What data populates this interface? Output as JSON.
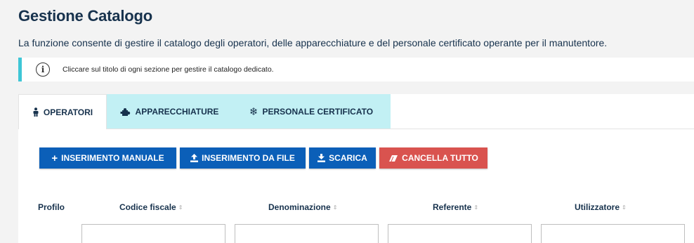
{
  "page": {
    "title": "Gestione Catalogo",
    "description": "La funzione consente di gestire il catalogo degli operatori, delle apparecchiature e del personale certificato operante per il manutentore."
  },
  "callout": {
    "icon": "info-icon",
    "text": "Cliccare sul titolo di ogni sezione per gestire il catalogo dedicato.",
    "accent_color": "#3ec6d6"
  },
  "tabs": [
    {
      "label": "OPERATORI",
      "icon": "person-icon",
      "active": true
    },
    {
      "label": "APPARECCHIATURE",
      "icon": "puzzle-icon",
      "active": false
    },
    {
      "label": "PERSONALE CERTIFICATO",
      "icon": "snowflake-icon",
      "active": false
    }
  ],
  "toolbar": {
    "manual_label": "INSERIMENTO MANUALE",
    "file_label": "INSERIMENTO DA FILE",
    "download_label": "SCARICA",
    "clear_label": "CANCELLA TUTTO",
    "primary_color": "#0b5fb8",
    "danger_color": "#d9534f"
  },
  "table": {
    "columns": [
      {
        "label": "Profilo",
        "sortable": false
      },
      {
        "label": "Codice fiscale",
        "sortable": true
      },
      {
        "label": "Denominazione",
        "sortable": true
      },
      {
        "label": "Referente",
        "sortable": true
      },
      {
        "label": "Utilizzatore",
        "sortable": true
      }
    ],
    "sort_icon": "⇕"
  }
}
